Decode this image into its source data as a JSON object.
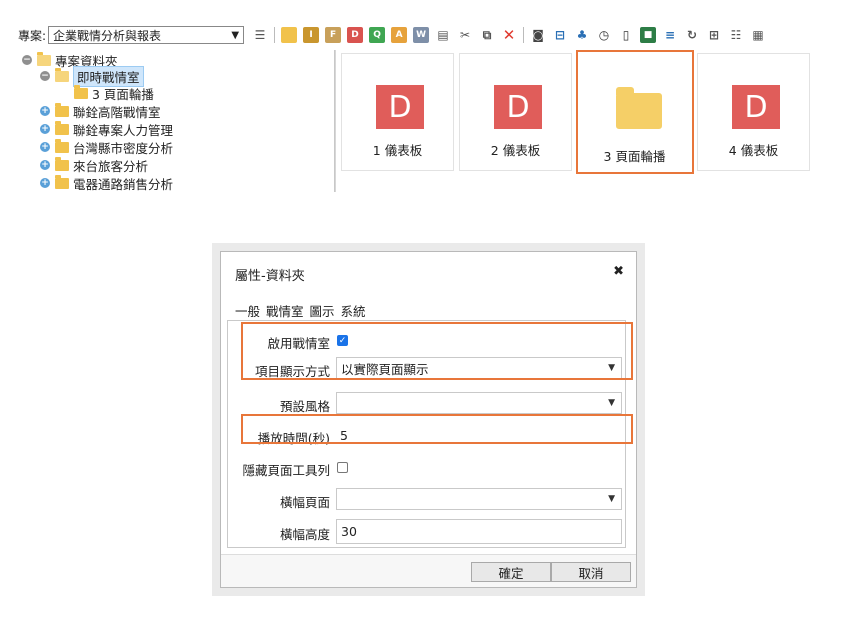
{
  "toolbar": {
    "project_label": "專案:",
    "project_value": "企業戰情分析與報表",
    "icons": [
      "list-icon",
      "add-folder-icon",
      "new-i-icon",
      "new-f-icon",
      "new-d-icon",
      "new-q-icon",
      "new-a-icon",
      "new-w-icon",
      "document-icon",
      "cut-icon",
      "copy-icon",
      "delete-icon",
      "camera-icon",
      "slideshow-icon",
      "puzzle-icon",
      "clock-icon",
      "book-icon",
      "tile-icon",
      "database-icon",
      "refresh-icon",
      "tree-icon",
      "layout-icon",
      "report-icon"
    ]
  },
  "tree": {
    "items": [
      {
        "label": "專案資料夾"
      },
      {
        "label": "即時戰情室"
      },
      {
        "label": "3 頁面輪播"
      },
      {
        "label": "聯銓高階戰情室"
      },
      {
        "label": "聯銓專案人力管理"
      },
      {
        "label": "台灣縣市密度分析"
      },
      {
        "label": "來台旅客分析"
      },
      {
        "label": "電器通路銷售分析"
      }
    ]
  },
  "tiles": [
    {
      "badge": "D",
      "label": "1 儀表板"
    },
    {
      "badge": "D",
      "label": "2 儀表板"
    },
    {
      "badge": "",
      "label": "3 頁面輪播"
    },
    {
      "badge": "D",
      "label": "4 儀表板"
    }
  ],
  "dialog": {
    "title": "屬性-資料夾",
    "close": "✖",
    "tabs": [
      "一般",
      "戰情室",
      "圖示",
      "系統"
    ],
    "fields": {
      "enable_label": "啟用戰情室",
      "display_mode_label": "項目顯示方式",
      "display_mode_value": "以實際頁面顯示",
      "default_style_label": "預設風格",
      "default_style_value": "",
      "play_time_label": "播放時間(秒)",
      "play_time_value": "5",
      "hide_toolbar_label": "隱藏頁面工具列",
      "banner_page_label": "橫幅頁面",
      "banner_page_value": "",
      "banner_height_label": "橫幅高度",
      "banner_height_value": "30"
    },
    "ok_label": "確定",
    "cancel_label": "取消"
  },
  "colors": {
    "highlight": "#e8763a",
    "badge": "#e05d5a",
    "folder": "#f5cf67",
    "selection": "#cfe6fb"
  }
}
